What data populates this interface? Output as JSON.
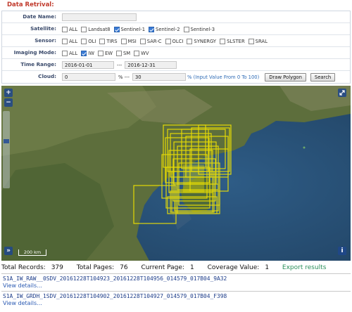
{
  "panel": {
    "title": "Data Retrival:"
  },
  "form": {
    "date_name": {
      "label": "Date Name:",
      "value": ""
    },
    "satellite": {
      "label": "Satellite:",
      "options": [
        {
          "label": "ALL",
          "checked": false
        },
        {
          "label": "Landsat8",
          "checked": false
        },
        {
          "label": "Sentinel-1",
          "checked": true
        },
        {
          "label": "Sentinel-2",
          "checked": true
        },
        {
          "label": "Sentinel-3",
          "checked": false
        }
      ]
    },
    "sensor": {
      "label": "Sensor:",
      "options": [
        {
          "label": "ALL",
          "checked": false
        },
        {
          "label": "OLI",
          "checked": false
        },
        {
          "label": "TIRS",
          "checked": false
        },
        {
          "label": "MSI",
          "checked": false
        },
        {
          "label": "SAR-C",
          "checked": false
        },
        {
          "label": "OLCI",
          "checked": false
        },
        {
          "label": "SYNERGY",
          "checked": false
        },
        {
          "label": "SLSTER",
          "checked": false
        },
        {
          "label": "SRAL",
          "checked": false
        }
      ]
    },
    "imaging_mode": {
      "label": "Imaging Mode:",
      "options": [
        {
          "label": "ALL",
          "checked": false
        },
        {
          "label": "IW",
          "checked": true
        },
        {
          "label": "EW",
          "checked": false
        },
        {
          "label": "SM",
          "checked": false
        },
        {
          "label": "WV",
          "checked": false
        }
      ]
    },
    "time_range": {
      "label": "Time Range:",
      "start": "2016-01-01",
      "separator": "---",
      "end": "2016-12-31"
    },
    "cloud": {
      "label": "Cloud:",
      "min": "0",
      "separator": "% ---",
      "max": "30",
      "hint": "% (Input Value From 0 To 100)",
      "draw_polygon": "Draw Polygon",
      "search": "Search"
    }
  },
  "map": {
    "zoom_in": "+",
    "zoom_out": "−",
    "fullscreen_icon": "expand-icon",
    "layers": "»",
    "info": "i",
    "scale_label": "200 km",
    "footprint_color": "#f2e400"
  },
  "results": {
    "total_records_label": "Total Records:",
    "total_records": "379",
    "total_pages_label": "Total Pages:",
    "total_pages": "76",
    "current_page_label": "Current Page:",
    "current_page": "1",
    "coverage_label": "Coverage Value:",
    "coverage": "1",
    "export": "Export results",
    "records": [
      {
        "name": "S1A_IW_RAW__0SDV_20161228T104923_20161228T104956_014579_017B04_9A32",
        "link": "View details..."
      },
      {
        "name": "S1A_IW_GRDH_1SDV_20161228T104902_20161228T104927_014579_017B04_F398",
        "link": "View details..."
      }
    ]
  }
}
